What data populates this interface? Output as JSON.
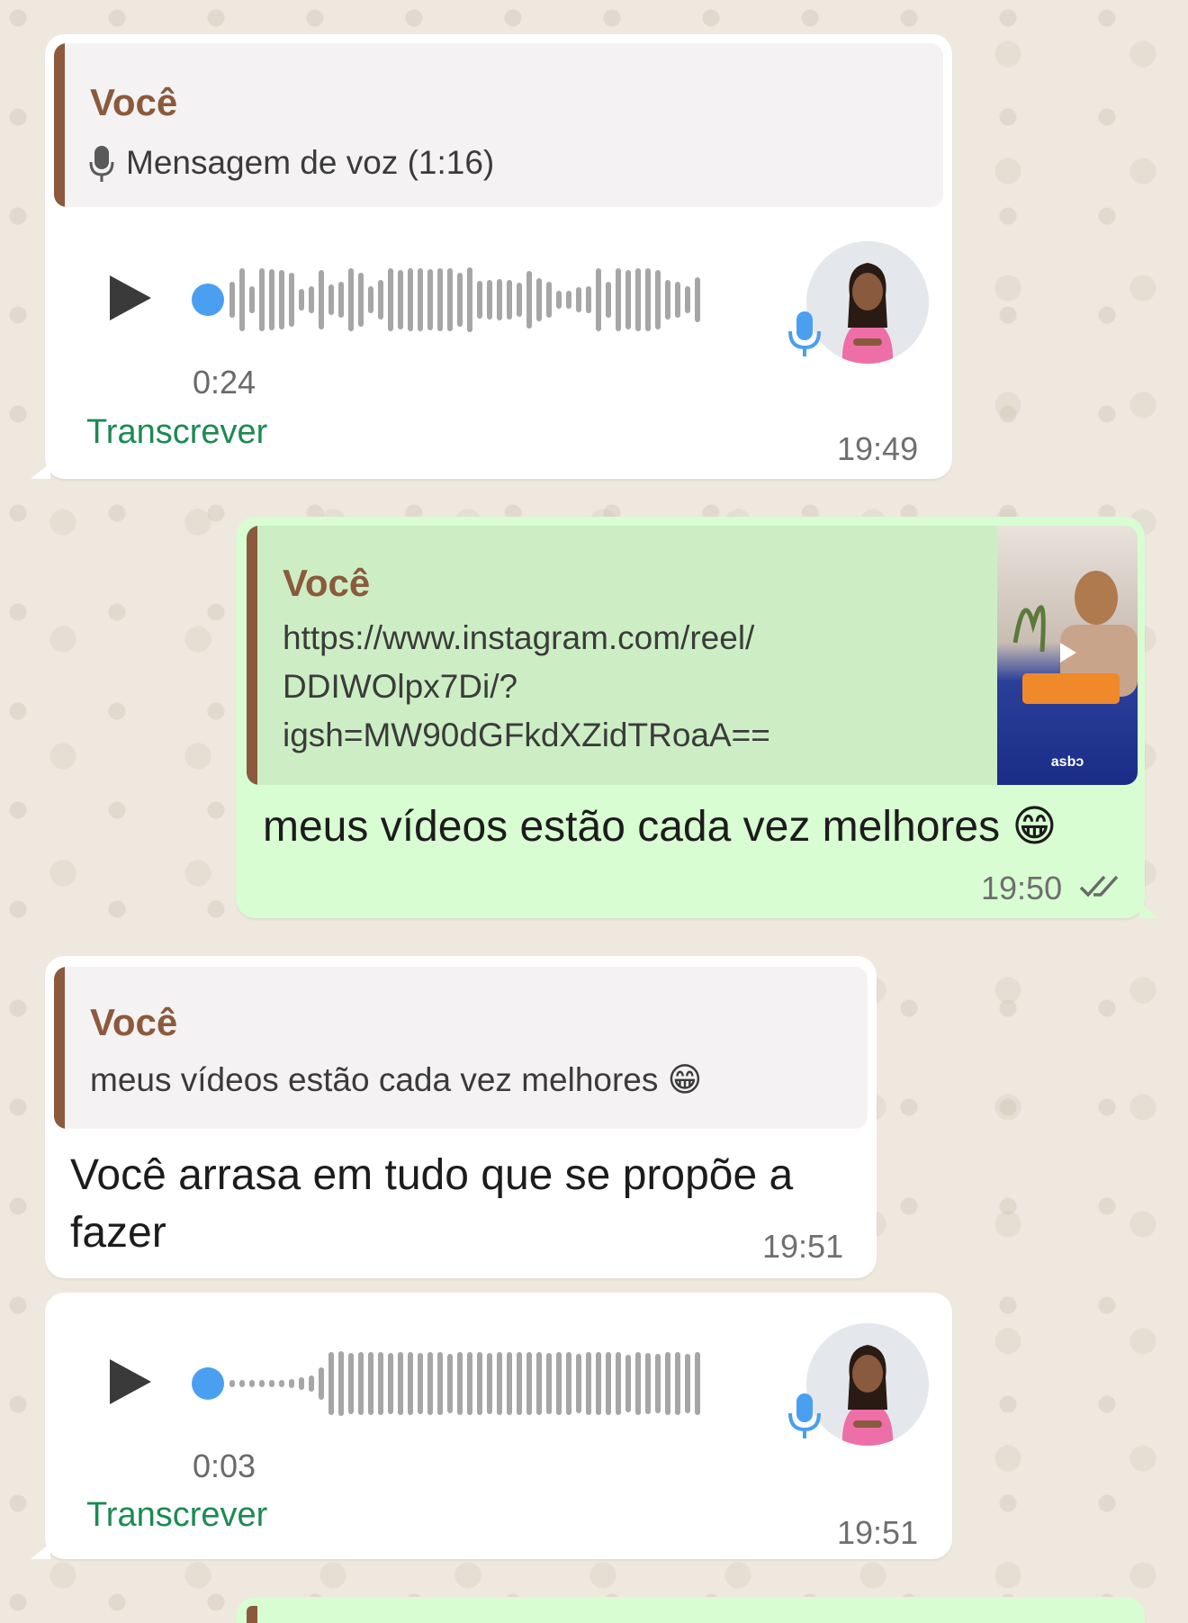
{
  "messages": [
    {
      "id": "m1",
      "quote": {
        "author": "Você",
        "text": "Mensagem de voz (1:16)",
        "icon": "microphone-icon"
      },
      "voice": {
        "duration": "0:24",
        "progress": 0.0,
        "transcribe_label": "Transcrever"
      },
      "time": "19:49"
    },
    {
      "id": "m2",
      "quote": {
        "author": "Você",
        "text": [
          "https://www.instagram.com/reel/",
          "DDIWOlpx7Di/?",
          "igsh=MW90dGFkdXZidTRoaA=="
        ],
        "thumb_icon": "video-play-icon",
        "thumb_logo": "asbɔ"
      },
      "text": "meus vídeos estão cada vez melhores 😁",
      "time": "19:50",
      "status_icon": "double-check-icon"
    },
    {
      "id": "m3",
      "quote": {
        "author": "Você",
        "text": "meus vídeos estão cada vez melhores 😁"
      },
      "text": [
        "Você arrasa em tudo que se propõe a",
        "fazer"
      ],
      "time": "19:51"
    },
    {
      "id": "m4",
      "voice": {
        "duration": "0:03",
        "progress": 0.0,
        "transcribe_label": "Transcrever"
      },
      "time": "19:51"
    }
  ],
  "colors": {
    "chat_background": "#efe8df",
    "incoming_bubble": "#ffffff",
    "outgoing_bubble": "#d8fdd2",
    "quote_author": "#8b5a3c",
    "transcribe_link": "#1c8a52",
    "voice_progress": "#4b9ff0",
    "waveform": "#a6a6a6"
  }
}
